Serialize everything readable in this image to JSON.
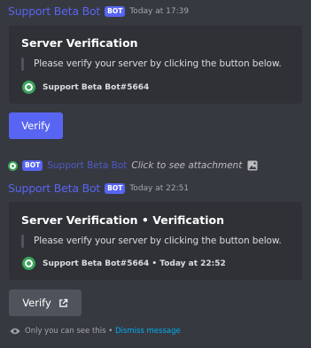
{
  "message1": {
    "author": "Support Beta Bot",
    "tag": "BOT",
    "timestamp": "Today at 17:39",
    "embed": {
      "title": "Server Verification",
      "description": "Please verify your server by clicking the button below.",
      "footer": "Support Beta Bot#5664"
    },
    "button_label": "Verify"
  },
  "reply": {
    "tag": "BOT",
    "author": "Support Beta Bot",
    "text": "Click to see attachment"
  },
  "message2": {
    "author": "Support Beta Bot",
    "tag": "BOT",
    "timestamp": "Today at 22:51",
    "embed": {
      "title": "Server Verification • Verification",
      "description": "Please verify your server by clicking the button below.",
      "footer": "Support Beta Bot#5664 • Today at 22:52"
    },
    "button_label": "Verify"
  },
  "ephemeral": {
    "notice": "Only you can see this •",
    "dismiss": "Dismiss message"
  },
  "colors": {
    "background": "#36393f",
    "embed": "#2f3136",
    "blurple": "#5865f2",
    "secondary_button": "#4f545c",
    "link": "#00aff4",
    "avatar_green": "#3ba55c"
  }
}
